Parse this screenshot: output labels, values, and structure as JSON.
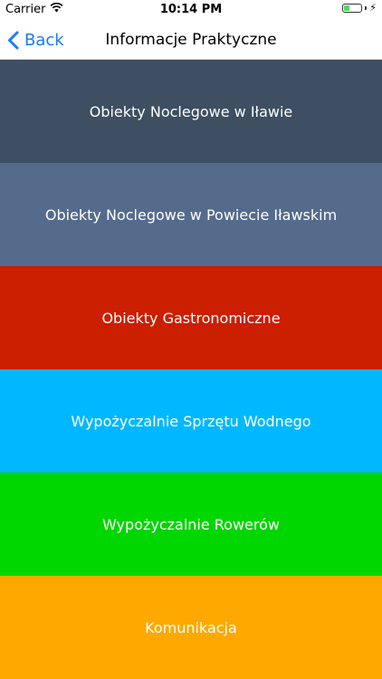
{
  "status_bar": {
    "carrier": "Carrier",
    "time": "10:14 PM",
    "battery_level": 0.35,
    "icons": [
      "wifi-icon",
      "battery-icon",
      "charging-icon"
    ]
  },
  "nav": {
    "back_label": "Back",
    "title": "Informacje Praktyczne",
    "accent_color": "#1a7cf5"
  },
  "menu": {
    "items": [
      {
        "label": "Obiekty Noclegowe w Iławie",
        "color": "#3d4f61"
      },
      {
        "label": "Obiekty Noclegowe w Powiecie Iławskim",
        "color": "#546b8c"
      },
      {
        "label": "Obiekty Gastronomiczne",
        "color": "#cc1e00"
      },
      {
        "label": "Wypożyczalnie Sprzętu Wodnego",
        "color": "#00b8ff"
      },
      {
        "label": "Wypożyczalnie Rowerów",
        "color": "#00d600"
      },
      {
        "label": "Komunikacja",
        "color": "#ffa800"
      }
    ]
  }
}
